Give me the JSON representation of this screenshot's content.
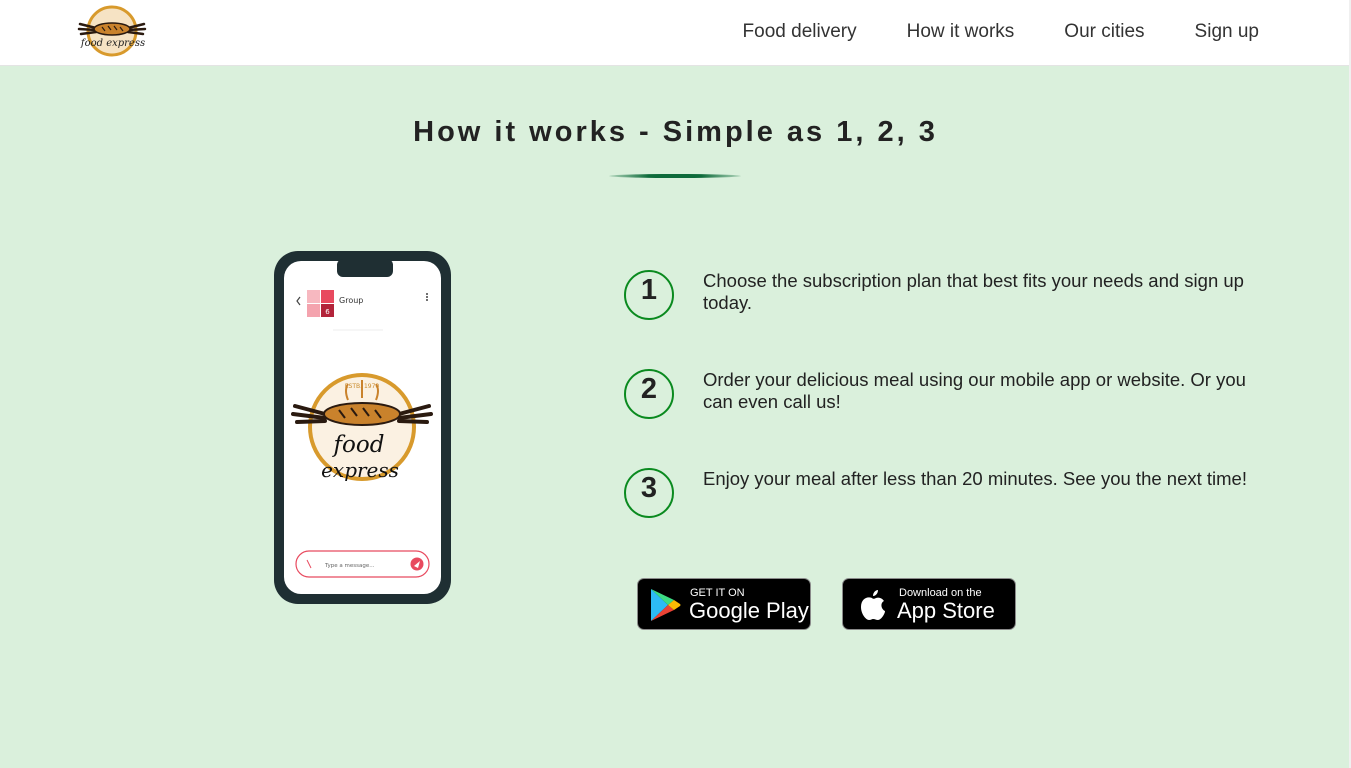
{
  "header": {
    "logo": {
      "icon": "food-express-logo",
      "text": "food express"
    },
    "nav": [
      {
        "label": "Food delivery"
      },
      {
        "label": "How it works"
      },
      {
        "label": "Our cities"
      },
      {
        "label": "Sign up"
      }
    ]
  },
  "section": {
    "title": "How it works - Simple as 1, 2, 3",
    "steps": [
      {
        "number": "1",
        "text": "Choose the subscription plan that best fits your needs and sign up today."
      },
      {
        "number": "2",
        "text": "Order your delicious meal using our mobile app or website. Or you can even call us!"
      },
      {
        "number": "3",
        "text": "Enjoy your meal after less than 20 minutes. See you the next time!"
      }
    ],
    "phone": {
      "chat_title": "Group",
      "badge": "6",
      "message_placeholder": "Type a message...",
      "logo_est": "ESTB. 1970",
      "logo_text_1": "food",
      "logo_text_2": "express"
    },
    "stores": {
      "google": {
        "small": "GET IT ON",
        "big": "Google Play"
      },
      "apple": {
        "small": "Download on the",
        "big": "App Store"
      }
    }
  },
  "colors": {
    "background": "#daf0dc",
    "accent_green": "#0a8a1f",
    "underline_green": "#0e6b3b",
    "phone_frame": "#1f2f33"
  }
}
